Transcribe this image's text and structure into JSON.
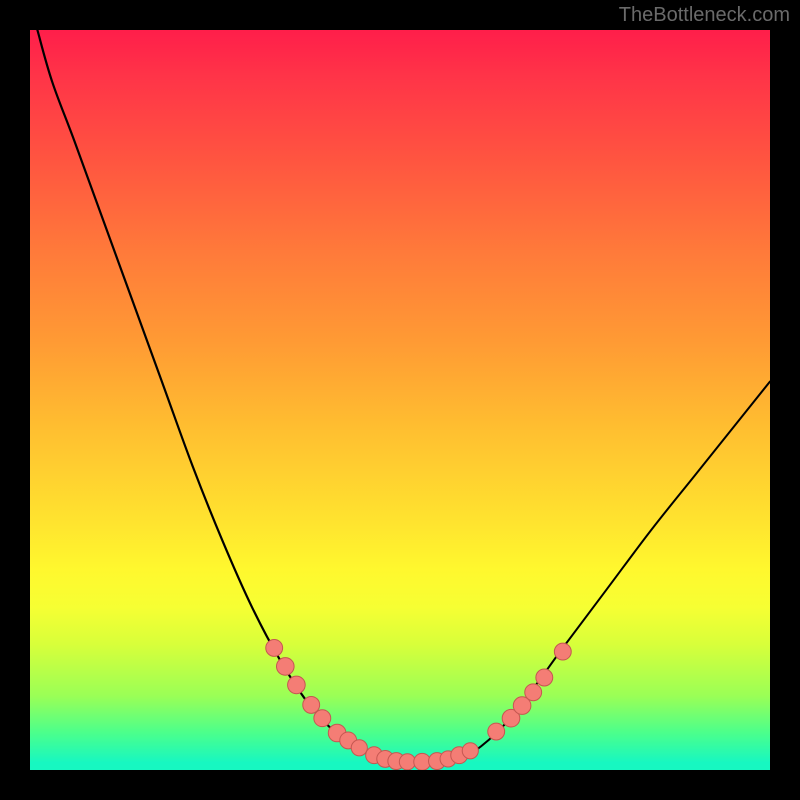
{
  "watermark": "TheBottleneck.com",
  "colors": {
    "frame": "#000000",
    "gradient_top": "#ff1e4a",
    "gradient_mid": "#ffe22f",
    "gradient_bottom": "#17f7c1",
    "curve": "#000000",
    "dot_fill": "#f47d75",
    "dot_stroke": "#c55751"
  },
  "chart_data": {
    "type": "line",
    "title": "",
    "xlabel": "",
    "ylabel": "",
    "xlim": [
      0,
      100
    ],
    "ylim": [
      0,
      100
    ],
    "grid": false,
    "legend": false,
    "left_branch": [
      {
        "x": 1,
        "y": 100
      },
      {
        "x": 3,
        "y": 93
      },
      {
        "x": 6,
        "y": 85
      },
      {
        "x": 10,
        "y": 74
      },
      {
        "x": 14,
        "y": 63
      },
      {
        "x": 18,
        "y": 52
      },
      {
        "x": 22,
        "y": 41
      },
      {
        "x": 26,
        "y": 31
      },
      {
        "x": 30,
        "y": 22
      },
      {
        "x": 34,
        "y": 14.5
      },
      {
        "x": 38,
        "y": 8.5
      },
      {
        "x": 42,
        "y": 4.5
      },
      {
        "x": 46,
        "y": 2.0
      },
      {
        "x": 49,
        "y": 1.1
      },
      {
        "x": 51,
        "y": 1.0
      },
      {
        "x": 53,
        "y": 1.0
      }
    ],
    "right_branch": [
      {
        "x": 55,
        "y": 1.0
      },
      {
        "x": 57,
        "y": 1.2
      },
      {
        "x": 60,
        "y": 2.5
      },
      {
        "x": 64,
        "y": 6.0
      },
      {
        "x": 68,
        "y": 11.0
      },
      {
        "x": 72,
        "y": 16.5
      },
      {
        "x": 78,
        "y": 24.5
      },
      {
        "x": 84,
        "y": 32.5
      },
      {
        "x": 90,
        "y": 40.0
      },
      {
        "x": 96,
        "y": 47.5
      },
      {
        "x": 100,
        "y": 52.5
      }
    ],
    "scatter_points": [
      {
        "x": 33.0,
        "y": 16.5,
        "r": 1.2
      },
      {
        "x": 34.5,
        "y": 14.0,
        "r": 1.3
      },
      {
        "x": 36.0,
        "y": 11.5,
        "r": 1.3
      },
      {
        "x": 38.0,
        "y": 8.8,
        "r": 1.2
      },
      {
        "x": 39.5,
        "y": 7.0,
        "r": 1.2
      },
      {
        "x": 41.5,
        "y": 5.0,
        "r": 1.3
      },
      {
        "x": 43.0,
        "y": 4.0,
        "r": 1.2
      },
      {
        "x": 44.5,
        "y": 3.0,
        "r": 1.1
      },
      {
        "x": 46.5,
        "y": 2.0,
        "r": 1.2
      },
      {
        "x": 48.0,
        "y": 1.5,
        "r": 1.2
      },
      {
        "x": 49.5,
        "y": 1.2,
        "r": 1.2
      },
      {
        "x": 51.0,
        "y": 1.1,
        "r": 1.1
      },
      {
        "x": 53.0,
        "y": 1.1,
        "r": 1.2
      },
      {
        "x": 55.0,
        "y": 1.2,
        "r": 1.2
      },
      {
        "x": 56.5,
        "y": 1.5,
        "r": 1.1
      },
      {
        "x": 58.0,
        "y": 2.0,
        "r": 1.2
      },
      {
        "x": 59.5,
        "y": 2.6,
        "r": 1.1
      },
      {
        "x": 63.0,
        "y": 5.2,
        "r": 1.2
      },
      {
        "x": 65.0,
        "y": 7.0,
        "r": 1.3
      },
      {
        "x": 66.5,
        "y": 8.7,
        "r": 1.3
      },
      {
        "x": 68.0,
        "y": 10.5,
        "r": 1.2
      },
      {
        "x": 69.5,
        "y": 12.5,
        "r": 1.2
      },
      {
        "x": 72.0,
        "y": 16.0,
        "r": 1.2
      }
    ]
  }
}
